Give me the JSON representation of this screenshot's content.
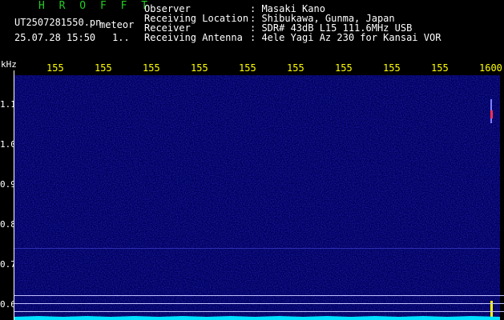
{
  "header": {
    "title": "H R O F F T",
    "filename": "UT2507281550.pn",
    "mode": "meteor",
    "datetime": "25.07.28 15:50",
    "index": "1.."
  },
  "info": [
    {
      "label": "Observer",
      "value": ": Masaki Kano"
    },
    {
      "label": "Receiving Location",
      "value": ": Shibukawa, Gunma, Japan"
    },
    {
      "label": "Receiver",
      "value": ": SDR# 43dB L15 111.6MHz USB"
    },
    {
      "label": "Receiving Antenna",
      "value": ": 4ele Yagi Az 230 for Kansai VOR"
    }
  ],
  "axis": {
    "unit": "kHz",
    "time_labels": [
      "155",
      "155",
      "155",
      "155",
      "155",
      "155",
      "155",
      "155",
      "155",
      "1600"
    ],
    "freq_labels": [
      "1.1",
      "1.0",
      "0.9",
      "0.8",
      "0.7",
      "0.6"
    ]
  },
  "colors": {
    "background": "#000000",
    "spectrogram": "#00007a",
    "title": "#22cc22",
    "axis_labels": "#ffff00",
    "noise_floor": "#00ffff"
  }
}
